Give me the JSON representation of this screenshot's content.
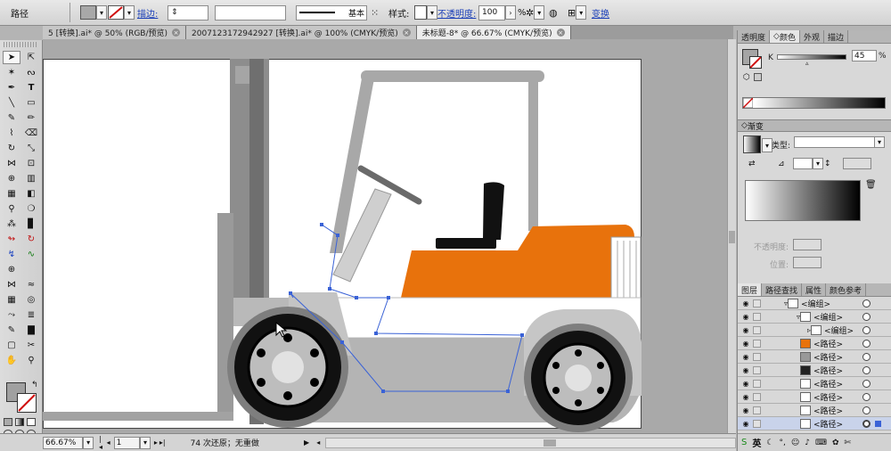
{
  "control_bar": {
    "object_type": "路径",
    "stroke_label": "描边:",
    "stroke_style_label": "基本",
    "style_label": "样式:",
    "opacity_label": "不透明度:",
    "opacity_value": "100",
    "opacity_unit": "%",
    "transform_label": "变换"
  },
  "doc_tabs": [
    {
      "label": "5 [转换].ai* @ 50% (RGB/预览)",
      "active": false
    },
    {
      "label": "2007123172942927 [转换].ai* @ 100% (CMYK/预览)",
      "active": false
    },
    {
      "label": "未标题-8* @ 66.67% (CMYK/预览)",
      "active": true
    }
  ],
  "status_bar": {
    "zoom": "66.67%",
    "page": "1",
    "undo_text": "74 次还原；无重做"
  },
  "color_panel": {
    "tabs": [
      "透明度",
      "颜色",
      "外观",
      "描边"
    ],
    "active_tab": "颜色",
    "channel_label": "K",
    "k_value": "45",
    "k_unit": "%"
  },
  "gradient_panel": {
    "title": "渐变",
    "type_label": "类型:",
    "opacity_label": "不透明度:",
    "position_label": "位置:"
  },
  "layers_panel": {
    "tabs": [
      "图层",
      "路径查找",
      "属性",
      "颜色参考"
    ],
    "active_tab": "图层",
    "rows": [
      "<编组>",
      "<编组>",
      "<编组>",
      "<路径>",
      "<路径>",
      "<路径>",
      "<路径>",
      "<路径>",
      "<路径>",
      "<路径>"
    ]
  },
  "ime": {
    "lang": "英"
  },
  "colors": {
    "accent_orange": "#e8720c",
    "selection_blue": "#3a62d6",
    "ui_gray": "#d6d6d6"
  }
}
